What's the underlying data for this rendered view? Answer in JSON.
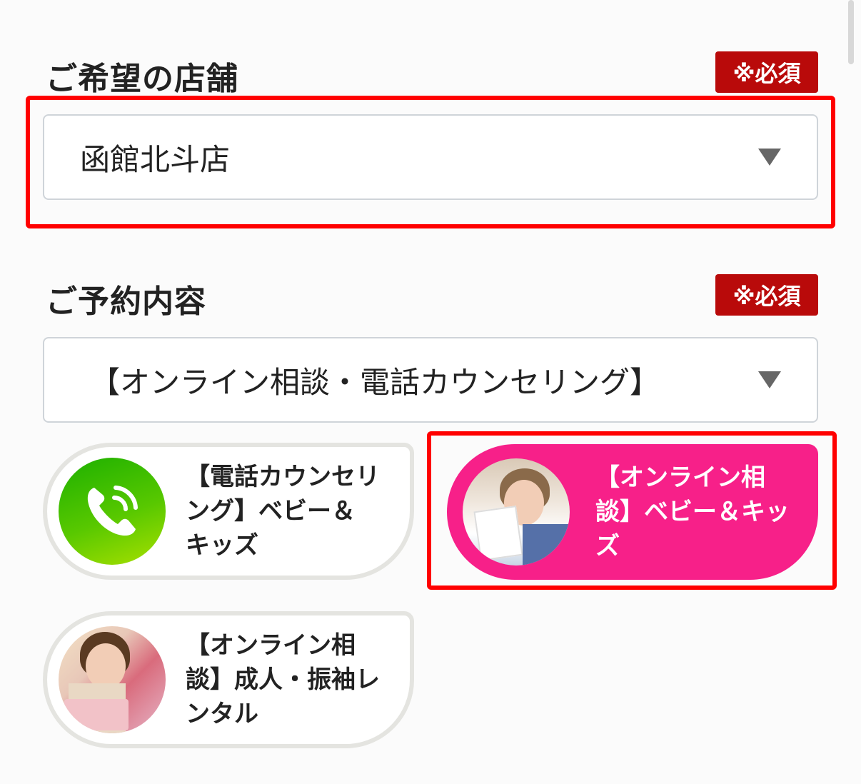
{
  "store_section": {
    "title": "ご希望の店舗",
    "required": "※必須",
    "selected_value": "函館北斗店"
  },
  "reservation_section": {
    "title": "ご予約内容",
    "required": "※必須",
    "selected_value": "【オンライン相談・電話カウンセリング】"
  },
  "options": [
    {
      "line1": "【電話カウンセリ",
      "line2": "ング】ベビー＆",
      "line3": "キッズ",
      "icon": "phone-icon",
      "state": "unselected"
    },
    {
      "line1": "【オンライン相",
      "line2": "談】ベビー＆キッ",
      "line3": "ズ",
      "icon": "photo",
      "state": "selected"
    },
    {
      "line1": "【オンライン相",
      "line2": "談】成人・振袖レ",
      "line3": "ンタル",
      "icon": "photo",
      "state": "unselected"
    }
  ],
  "colors": {
    "required_badge": "#b90a0a",
    "highlight": "#ff0000",
    "selected_option": "#f72089",
    "phone_green": "#3ebd00"
  }
}
